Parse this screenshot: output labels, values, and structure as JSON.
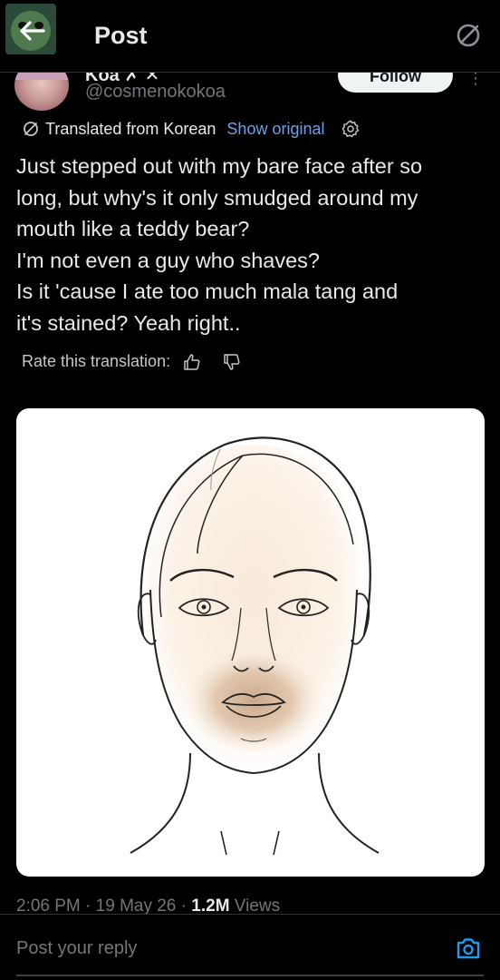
{
  "header": {
    "title": "Post",
    "back_icon": "arrow-left-icon",
    "right_icon": "no-translate-icon"
  },
  "user": {
    "display_name": "Koa ✗ ✕",
    "handle": "@cosmenokokoa",
    "follow_label": "Follow",
    "more_icon": "more-vertical-icon"
  },
  "translation": {
    "label": "Translated from Korean",
    "show_original": "Show original",
    "settings_icon": "gear-icon"
  },
  "post": {
    "lines": [
      "Just stepped out with my bare face after so",
      "long, but why's it only smudged around my",
      "mouth like a teddy bear?",
      "I'm not even a guy who shaves?",
      "Is it 'cause I ate too much mala tang and",
      "it's stained? Yeah right.."
    ]
  },
  "rate": {
    "label": "Rate this translation:",
    "thumbs_up_icon": "thumbs-up-icon",
    "thumbs_down_icon": "thumbs-down-icon"
  },
  "meta": {
    "time": "2:06 PM",
    "sep1": " · ",
    "date": "19 May 26",
    "sep2": " · ",
    "views_count": "1.2M",
    "views_label": " Views"
  },
  "reply": {
    "placeholder": "Post your reply",
    "camera_icon": "camera-icon"
  },
  "colors": {
    "background": "#000000",
    "text": "#e7e9ea",
    "muted": "#71767b",
    "link": "#6aa3e0",
    "follow_bg": "#eff3f4"
  }
}
